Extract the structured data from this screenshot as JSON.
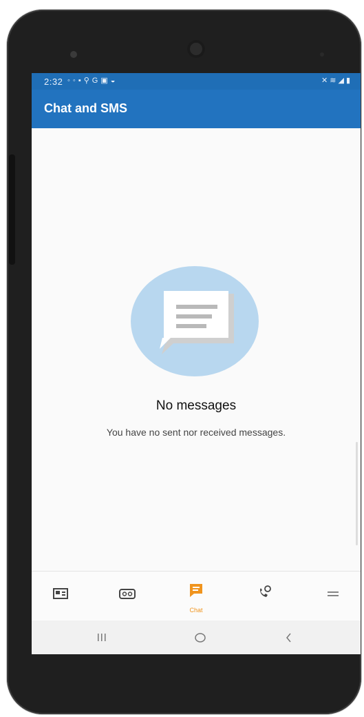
{
  "status_bar": {
    "time": "2:32",
    "left_icons": [
      "voicemail-icon",
      "lock-icon",
      "accessibility-icon",
      "google-icon",
      "gallery-icon",
      "app-icon"
    ],
    "right_icons": [
      "mute-icon",
      "wifi-icon",
      "signal-icon",
      "battery-icon"
    ]
  },
  "app_bar": {
    "title": "Chat and SMS"
  },
  "empty_state": {
    "title": "No messages",
    "subtitle": "You have no sent nor received messages."
  },
  "fab": {
    "icon": "pencil-icon"
  },
  "bottom_nav": {
    "items": [
      {
        "icon": "contact-card-icon",
        "label": ""
      },
      {
        "icon": "voicemail-icon",
        "label": ""
      },
      {
        "icon": "chat-icon",
        "label": "Chat",
        "active": true
      },
      {
        "icon": "call-history-icon",
        "label": ""
      },
      {
        "icon": "menu-icon",
        "label": ""
      }
    ],
    "active_color": "#f0941e"
  },
  "system_nav": {
    "buttons": [
      "recents",
      "home",
      "back"
    ]
  },
  "colors": {
    "app_bar": "#2273bf",
    "status_bar": "#1f6eb6",
    "accent": "#f0941e",
    "illustration": "#b8d7ef"
  }
}
